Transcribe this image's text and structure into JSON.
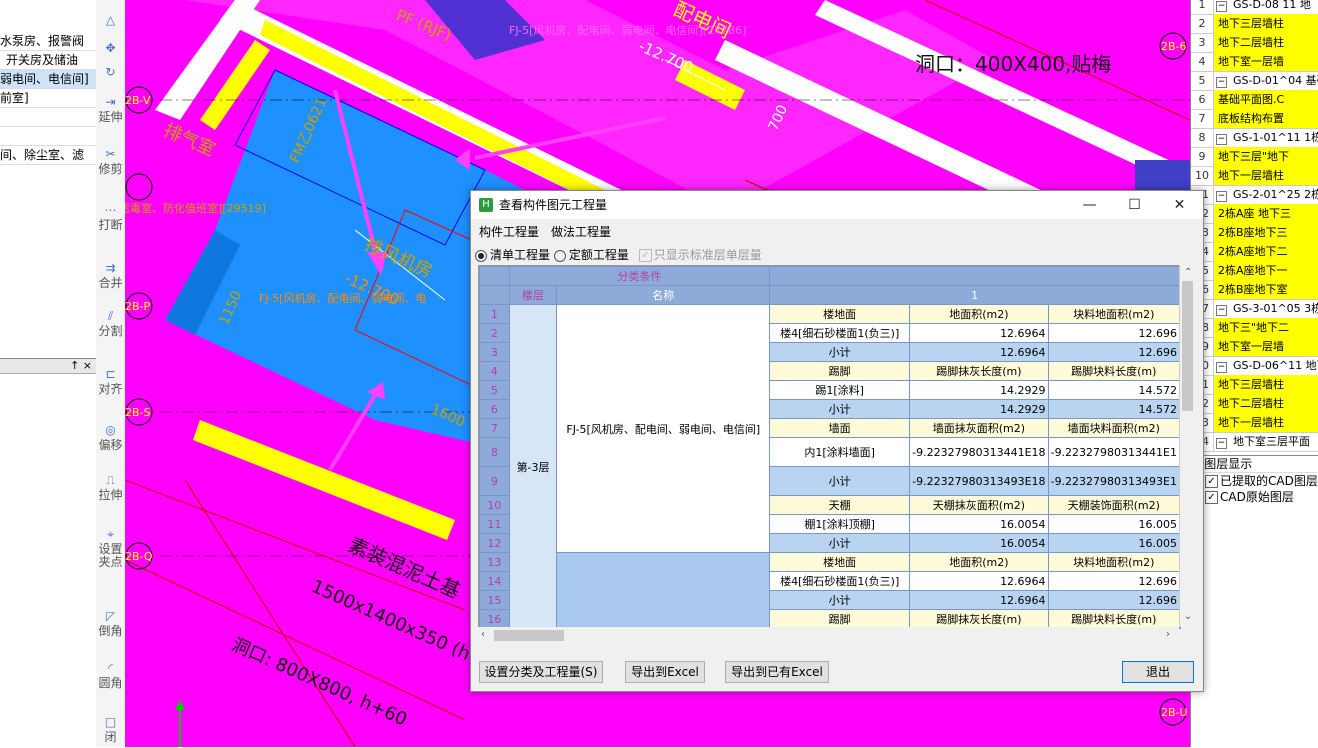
{
  "left_panel": {
    "items": [
      "水泵房、报警阀",
      "开关房及储油",
      "弱电间、电信间]",
      "前室]",
      "",
      "间、除尘室、滤"
    ],
    "lower_header": "↑ ×"
  },
  "toolbar": [
    {
      "icon": "extend-icon",
      "label": "延伸"
    },
    {
      "icon": "trim-icon",
      "label": "修剪"
    },
    {
      "icon": "break-icon",
      "label": "打断"
    },
    {
      "icon": "merge-icon",
      "label": "合并"
    },
    {
      "icon": "split-icon",
      "label": "分割"
    },
    {
      "icon": "align-icon",
      "label": "对齐"
    },
    {
      "icon": "offset-icon",
      "label": "偏移"
    },
    {
      "icon": "stretch-icon",
      "label": "拉伸"
    },
    {
      "icon": "grip-icon",
      "label": "设置夹点"
    },
    {
      "icon": "chamfer-icon",
      "label": "倒角"
    },
    {
      "icon": "fillet-icon",
      "label": "圆角"
    },
    {
      "icon": "close-icon",
      "label": "闭"
    }
  ],
  "cad": {
    "labels": {
      "peidian": "配电间",
      "fj_top": "FJ-5[风机房、配电间、弱电间、电信间][27786]",
      "pf": "PF (RJF)",
      "elev1": "-12.700",
      "dongkou1": "洞口：400X400,贴梅",
      "paiqi": "排气室",
      "fm": "FM乙0621",
      "lvdu": "滤毒室、防化值班室][29519]",
      "paifeng": "排风机房",
      "elev2": "-12.700",
      "fj_mid": "FJ-5[风机房、配电间、弱电间、电",
      "d1150": "1150",
      "d1600": "1600",
      "d700": "700",
      "sumu": "素装混泥土基",
      "size": "1500x1400x350 (h",
      "dongkou2": "洞口: 800X800, h+60",
      "axis": [
        "2B-V",
        "2B-S",
        "2B-Q",
        "2B-P",
        "2B-6",
        "2B-U"
      ]
    }
  },
  "right_panel": {
    "rows": [
      {
        "n": "1",
        "box": "−",
        "t": "GS-D-08 11 地",
        "y": false
      },
      {
        "n": "2",
        "box": "",
        "t": "地下三层墙柱",
        "y": true
      },
      {
        "n": "3",
        "box": "",
        "t": "地下二层墙柱",
        "y": true
      },
      {
        "n": "4",
        "box": "",
        "t": "地下室一层墙",
        "y": true
      },
      {
        "n": "5",
        "box": "−",
        "t": "GS-D-01^04 基础",
        "y": false
      },
      {
        "n": "6",
        "box": "",
        "t": "基础平面图.C",
        "y": true
      },
      {
        "n": "7",
        "box": "",
        "t": "底板结构布置",
        "y": true
      },
      {
        "n": "8",
        "box": "−",
        "t": "GS-1-01^11 1栋",
        "y": false
      },
      {
        "n": "9",
        "box": "",
        "t": "地下三层\"地下",
        "y": true
      },
      {
        "n": "10",
        "box": "",
        "t": "地下一层墙柱",
        "y": true
      },
      {
        "n": "11",
        "box": "−",
        "t": "GS-2-01^25 2栋",
        "y": false
      },
      {
        "n": "12",
        "box": "",
        "t": "2栋A座 地下三",
        "y": true
      },
      {
        "n": "13",
        "box": "",
        "t": "2栋B座地下三",
        "y": true
      },
      {
        "n": "14",
        "box": "",
        "t": "2栋A座地下二",
        "y": true
      },
      {
        "n": "15",
        "box": "",
        "t": "2栋A座地下一",
        "y": true
      },
      {
        "n": "16",
        "box": "",
        "t": "2栋B座地下室",
        "y": true
      },
      {
        "n": "17",
        "box": "−",
        "t": "GS-3-01^05 3栋",
        "y": false
      },
      {
        "n": "18",
        "box": "",
        "t": "地下三\"地下二",
        "y": true
      },
      {
        "n": "19",
        "box": "",
        "t": "地下室一层墙",
        "y": true
      },
      {
        "n": "20",
        "box": "−",
        "t": "GS-D-06^11 地下",
        "y": false
      },
      {
        "n": "21",
        "box": "",
        "t": "地下三层墙柱",
        "y": true
      },
      {
        "n": "22",
        "box": "",
        "t": "地下二层墙柱",
        "y": true
      },
      {
        "n": "23",
        "box": "",
        "t": "地下一层墙柱",
        "y": true
      },
      {
        "n": "24",
        "box": "−",
        "t": "地下室三层平面",
        "y": false
      }
    ],
    "layers_title": "D图层显示",
    "layer1": "已提取的CAD图层",
    "layer2": "CAD原始图层"
  },
  "dialog": {
    "title": "查看构件图元工程量",
    "tab1": "构件工程量",
    "tab2": "做法工程量",
    "opt1": "清单工程量",
    "opt2": "定额工程量",
    "opt3": "只显示标准层单层量",
    "hdr_group": "分类条件",
    "hdr_floor": "楼层",
    "hdr_name": "名称",
    "hdr_col": "1",
    "floor": "第-3层",
    "name": "FJ-5[风机房、配电间、弱电间、电信间]",
    "rows": [
      {
        "n": "1",
        "a": "楼地面",
        "b": "地面积(m2)",
        "c": "块料地面积(m2)",
        "k": "ty"
      },
      {
        "n": "2",
        "a": "楼4[细石砂楼面1(负三)]",
        "b": "12.6964",
        "c": "12.696",
        "k": "it"
      },
      {
        "n": "3",
        "a": "小计",
        "b": "12.6964",
        "c": "12.696",
        "k": "st"
      },
      {
        "n": "4",
        "a": "踢脚",
        "b": "踢脚抹灰长度(m)",
        "c": "踢脚块料长度(m)",
        "k": "ty"
      },
      {
        "n": "5",
        "a": "踢1[涂料]",
        "b": "14.2929",
        "c": "14.572",
        "k": "it"
      },
      {
        "n": "6",
        "a": "小计",
        "b": "14.2929",
        "c": "14.572",
        "k": "st"
      },
      {
        "n": "7",
        "a": "墙面",
        "b": "墙面抹灰面积(m2)",
        "c": "墙面块料面积(m2)",
        "k": "ty"
      },
      {
        "n": "8",
        "a": "内1[涂料墙面]",
        "b": "-9.22327980313441E18",
        "c": "-9.22327980313441E1",
        "k": "it"
      },
      {
        "n": "9",
        "a": "小计",
        "b": "-9.22327980313493E18",
        "c": "-9.22327980313493E1",
        "k": "st"
      },
      {
        "n": "10",
        "a": "天棚",
        "b": "天棚抹灰面积(m2)",
        "c": "天棚装饰面积(m2)",
        "k": "ty"
      },
      {
        "n": "11",
        "a": "棚1[涂料顶棚]",
        "b": "16.0054",
        "c": "16.005",
        "k": "it"
      },
      {
        "n": "12",
        "a": "小计",
        "b": "16.0054",
        "c": "16.005",
        "k": "st"
      },
      {
        "n": "13",
        "a": "楼地面",
        "b": "地面积(m2)",
        "c": "块料地面积(m2)",
        "k": "ty"
      },
      {
        "n": "14",
        "a": "楼4[细石砂楼面1(负三)]",
        "b": "12.6964",
        "c": "12.696",
        "k": "it"
      },
      {
        "n": "15",
        "a": "小计",
        "b": "12.6964",
        "c": "12.696",
        "k": "st"
      },
      {
        "n": "16",
        "a": "踢脚",
        "b": "踢脚抹灰长度(m)",
        "c": "踢脚块料长度(m)",
        "k": "ty"
      }
    ],
    "btn_setup": "设置分类及工程量(S)",
    "btn_export": "导出到Excel",
    "btn_export2": "导出到已有Excel",
    "btn_exit": "退出"
  }
}
